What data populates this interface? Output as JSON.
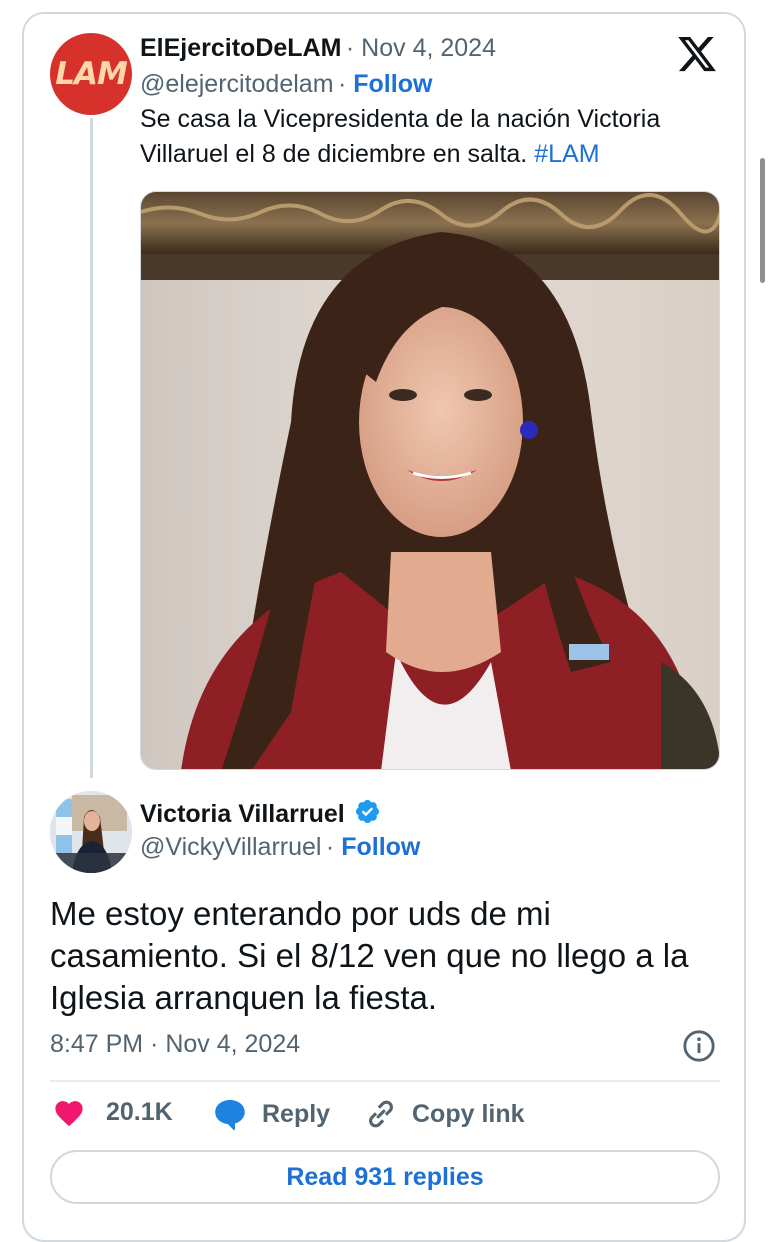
{
  "quoted_tweet": {
    "avatar_text": "LAM",
    "author_name": "ElEjercitoDeLAM",
    "date": "Nov 4, 2024",
    "handle": "@elejercitodelam",
    "follow_label": "Follow",
    "text": "Se casa la Vicepresidenta de la nación Victoria Villaruel el 8 de diciembre en salta.",
    "hashtag": "#LAM"
  },
  "main_tweet": {
    "author_name": "Victoria Villarruel",
    "handle": "@VickyVillarruel",
    "follow_label": "Follow",
    "text": "Me estoy enterando por uds de mi casamiento. Si el 8/12 ven que no llego a la Iglesia arranquen la fiesta.",
    "timestamp": "8:47 PM · Nov 4, 2024"
  },
  "actions": {
    "likes_count": "20.1K",
    "reply_label": "Reply",
    "copy_link_label": "Copy link"
  },
  "read_replies_label": "Read 931 replies",
  "colors": {
    "accent": "#1d70d6",
    "like": "#f0186e",
    "muted": "#536471",
    "border": "#cfd9de"
  },
  "icons": [
    "x-logo-icon",
    "verified-badge-icon",
    "info-icon",
    "heart-icon",
    "reply-bubble-icon",
    "link-icon"
  ]
}
